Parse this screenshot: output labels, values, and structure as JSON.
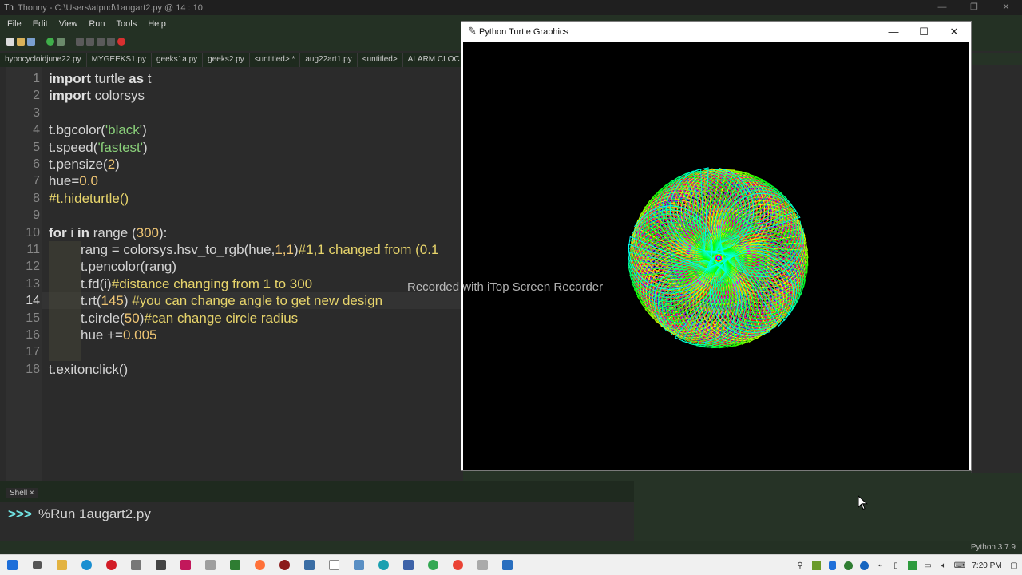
{
  "thonny": {
    "title": "Thonny  -  C:\\Users\\atpnd\\1augart2.py  @  14 : 10",
    "menu": [
      "File",
      "Edit",
      "View",
      "Run",
      "Tools",
      "Help"
    ],
    "tabs": [
      "hypocycloidjune22.py",
      "MYGEEKS1.py",
      "geeks1a.py",
      "geeks2.py",
      "<untitled> *",
      "aug22art1.py",
      "<untitled>",
      "ALARM CLOC"
    ],
    "shell_tab": "Shell ×",
    "shell_prompt": ">>>",
    "shell_command": "%Run 1augart2.py",
    "status": "Python 3.7.9"
  },
  "code": {
    "l1_kw1": "import",
    "l1_rest": " turtle ",
    "l1_kw2": "as",
    "l1_t": " t",
    "l2_kw": "import",
    "l2_rest": " colorsys",
    "l4_a": "t.bgcolor(",
    "l4_s": "'black'",
    "l4_b": ")",
    "l5_a": "t.speed(",
    "l5_s": "'fastest'",
    "l5_b": ")",
    "l6_a": "t.pensize(",
    "l6_n": "2",
    "l6_b": ")",
    "l7_a": "hue=",
    "l7_n": "0.0",
    "l8_c": "#t.hideturtle()",
    "l10_kw1": "for",
    "l10_a": " i ",
    "l10_kw2": "in",
    "l10_b": " range (",
    "l10_n": "300",
    "l10_c": "):",
    "l11_a": "rang = colorsys.hsv_to_rgb(hue,",
    "l11_n": "1,1",
    "l11_b": ")",
    "l11_c": "#1,1 changed from (0.1",
    "l12_a": "t.pencolor(rang)",
    "l13_a": "t.fd(i)",
    "l13_c": "#distance changing from 1 to 300",
    "l14_a": "t.rt(",
    "l14_n": "145",
    "l14_b": ") ",
    "l14_c": "#you can change angle to get new design",
    "l15_a": "t.circle(",
    "l15_n": "50",
    "l15_b": ")",
    "l15_c": "#can change circle radius",
    "l16_a": "hue +=",
    "l16_n": "0.005",
    "l18_a": "t.exitonclick()"
  },
  "line_numbers": [
    "1",
    "2",
    "3",
    "4",
    "5",
    "6",
    "7",
    "8",
    "9",
    "10",
    "11",
    "12",
    "13",
    "14",
    "15",
    "16",
    "17",
    "18"
  ],
  "turtle_window": {
    "title": "Python Turtle Graphics",
    "minimize": "—",
    "maximize": "☐",
    "close": "✕"
  },
  "watermark": "Recorded with iTop Screen Recorder",
  "taskbar": {
    "clock": "7:20 PM"
  },
  "colors": {
    "editor_bg": "#2b2b2b",
    "turtle_bg": "#000000",
    "keyword": "#e0e0e0",
    "string": "#8ad07a",
    "number": "#f0c674",
    "comment": "#e7d46b"
  },
  "turtle_program": {
    "steps": 300,
    "angle": 145,
    "radius": 50,
    "hue_step": 0.005,
    "pensize": 2
  }
}
